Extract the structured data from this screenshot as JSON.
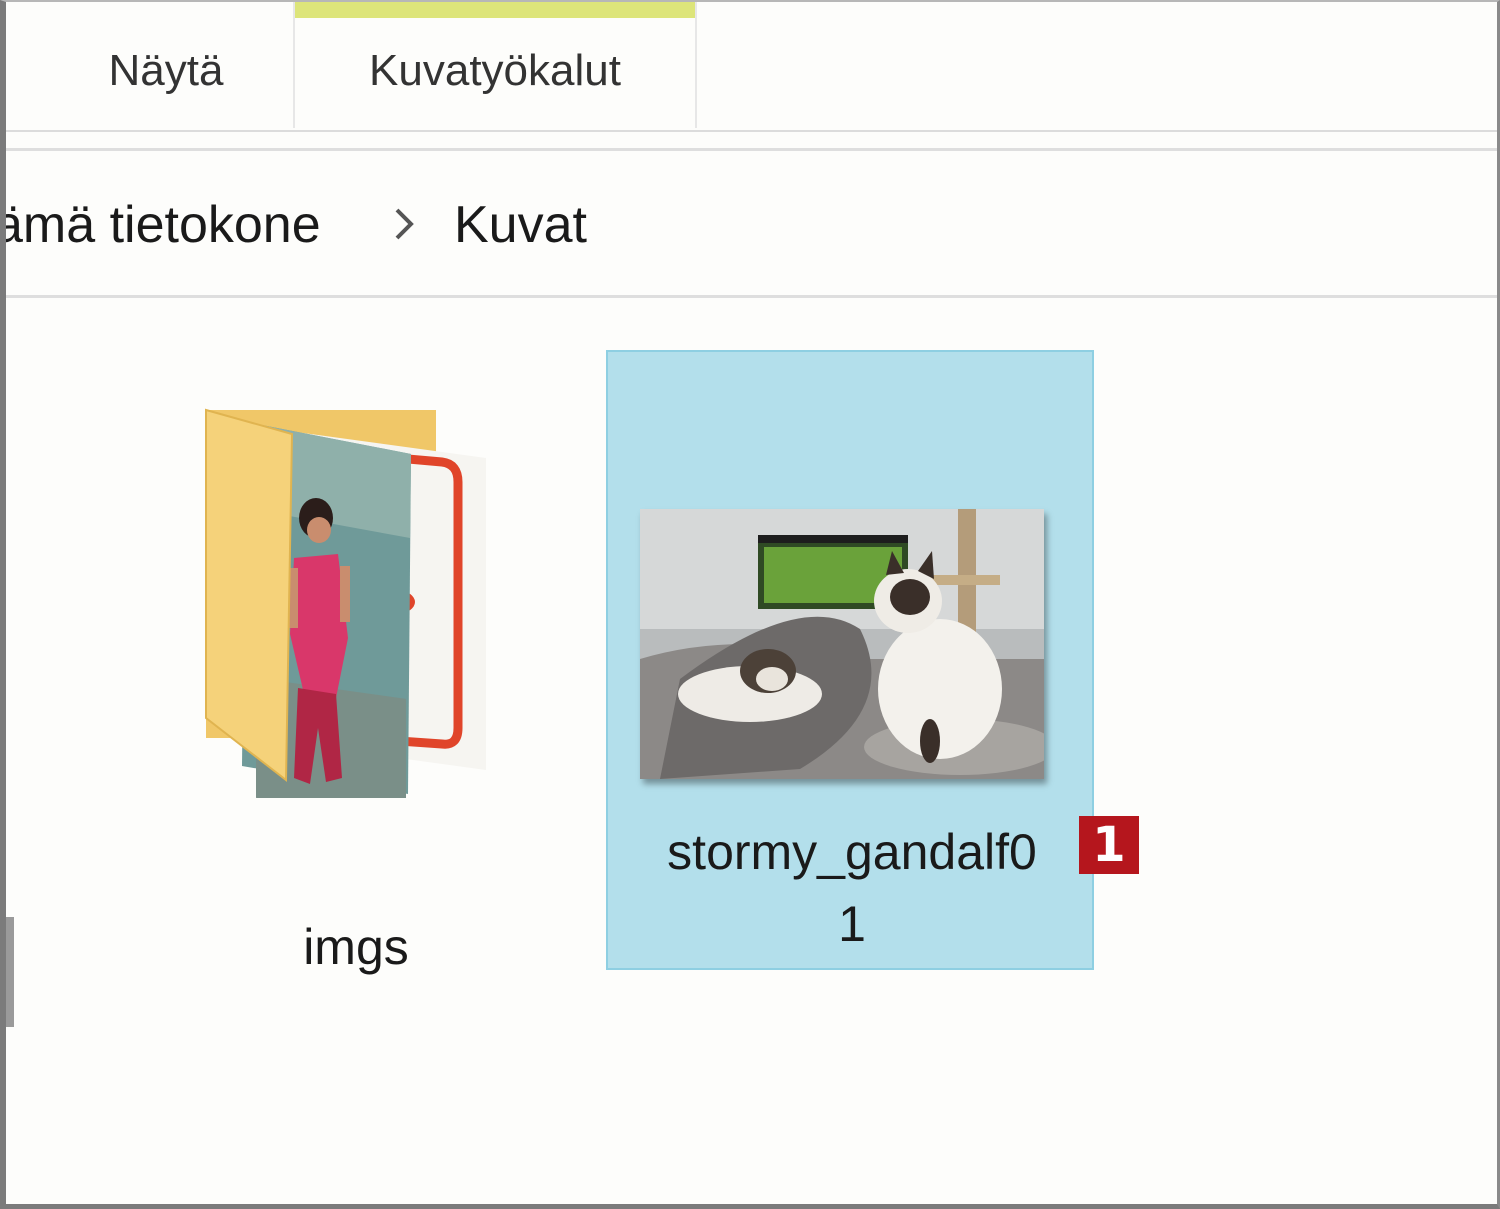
{
  "ribbon": {
    "tabs": [
      {
        "label": "Näytä"
      },
      {
        "label": "Kuvatyökalut"
      }
    ]
  },
  "address_bar": {
    "crumbs": [
      "ämä tietokone",
      "Kuvat"
    ],
    "separator_icon": "chevron-right-icon"
  },
  "items": [
    {
      "type": "folder",
      "name": "imgs",
      "icon": "folder-with-pictures-icon"
    },
    {
      "type": "image",
      "name_line1": "stormy_gandalf0",
      "name_line2": "1",
      "selected": true,
      "thumbnail": "two-cats-on-sofa-thumbnail"
    }
  ],
  "callout": {
    "label": "1"
  },
  "colors": {
    "selection_bg": "#b3dfeb",
    "selection_border": "#8ecfe2",
    "tab_highlight": "#dde57a",
    "callout_bg": "#b5161d"
  }
}
